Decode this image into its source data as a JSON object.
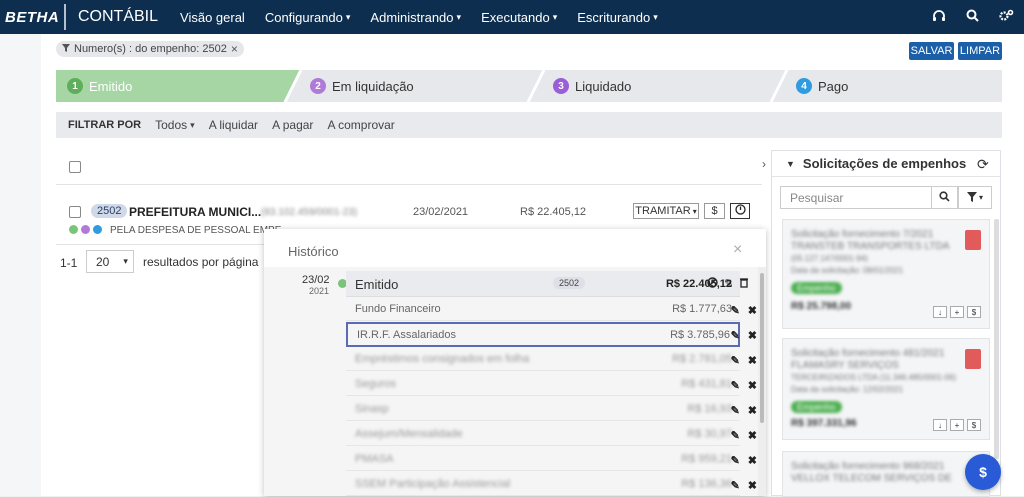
{
  "topbar": {
    "logo": "BETHA",
    "app": "CONTÁBIL",
    "menus": [
      "Visão geral",
      "Configurando",
      "Administrando",
      "Executando",
      "Escriturando"
    ]
  },
  "filter_chip": "Numero(s) : do empenho: 2502",
  "actions": {
    "save": "SALVAR",
    "clear": "LIMPAR"
  },
  "steps": [
    {
      "num": "1",
      "label": "Emitido",
      "color": "#7ac47a"
    },
    {
      "num": "2",
      "label": "Em liquidação",
      "color": "#b07ad9"
    },
    {
      "num": "3",
      "label": "Liquidado",
      "color": "#9a5ed6"
    },
    {
      "num": "4",
      "label": "Pago",
      "color": "#2f9be0"
    }
  ],
  "filter_bar": {
    "title": "FILTRAR POR",
    "options": [
      "Todos",
      "A liquidar",
      "A pagar",
      "A comprovar"
    ]
  },
  "record": {
    "badge": "2502",
    "name": "PREFEITURA MUNICI...",
    "cnpj": "(83.102.459/0001-23)",
    "date": "23/02/2021",
    "value": "R$ 22.405,12",
    "tramitar": "TRAMITAR",
    "money": "$",
    "desc": "PELA DESPESA DE PESSOAL EMPE"
  },
  "pagination": {
    "range": "1-1",
    "per_page": "20",
    "label": "resultados por página"
  },
  "history": {
    "title": "Histórico",
    "close": "×",
    "date": "23/02",
    "year": "2021",
    "event": "Emitido",
    "badge": "2502",
    "total": "R$ 22.405,12",
    "rows": [
      {
        "name": "Fundo Financeiro",
        "value": "R$ 1.777,63"
      },
      {
        "name": "IR.R.F. Assalariados",
        "value": "R$ 3.785,96"
      },
      {
        "name": "Empréstimos consignados em folha",
        "value": "R$ 2.781,05"
      },
      {
        "name": "Seguros",
        "value": "R$ 431,81"
      },
      {
        "name": "Sinasp",
        "value": "R$ 16,93"
      },
      {
        "name": "Assejum/Mensalidade",
        "value": "R$ 30,97"
      },
      {
        "name": "PMASA",
        "value": "R$ 959,21"
      },
      {
        "name": "SSEM Participação Assistencial",
        "value": "R$ 136,36"
      }
    ]
  },
  "panel": {
    "title": "Solicitações de empenhos",
    "search_placeholder": "Pesquisar",
    "cards": [
      {
        "l1": "Solicitação fornecimento 7/2021",
        "l2": "TRANSTEB TRANSPORTES LTDA",
        "l3": "(05.127.147/0001-94)",
        "l4": "Data da solicitação: 08/01/2021",
        "status": "Empenho",
        "amount": "R$ 25.798,00"
      },
      {
        "l1": "Solicitação fornecimento 481/2021",
        "l2": "FLAMASRY SERVIÇOS",
        "l3": "TERCEIRIZADOS LTDA (11.346.485/0001-06)",
        "l4": "Data da solicitação: 12/02/2021",
        "status": "Empenho",
        "amount": "R$ 397.331,96"
      },
      {
        "l1": "Solicitação fornecimento 968/2021",
        "l2": "VELLOX TELECOM SERVIÇOS DE",
        "l3": "",
        "l4": "",
        "status": "",
        "amount": ""
      }
    ]
  },
  "colors": {
    "topbar": "#0d2e4e",
    "primary": "#1a5fa8",
    "active_step": "#a6d6a3"
  }
}
